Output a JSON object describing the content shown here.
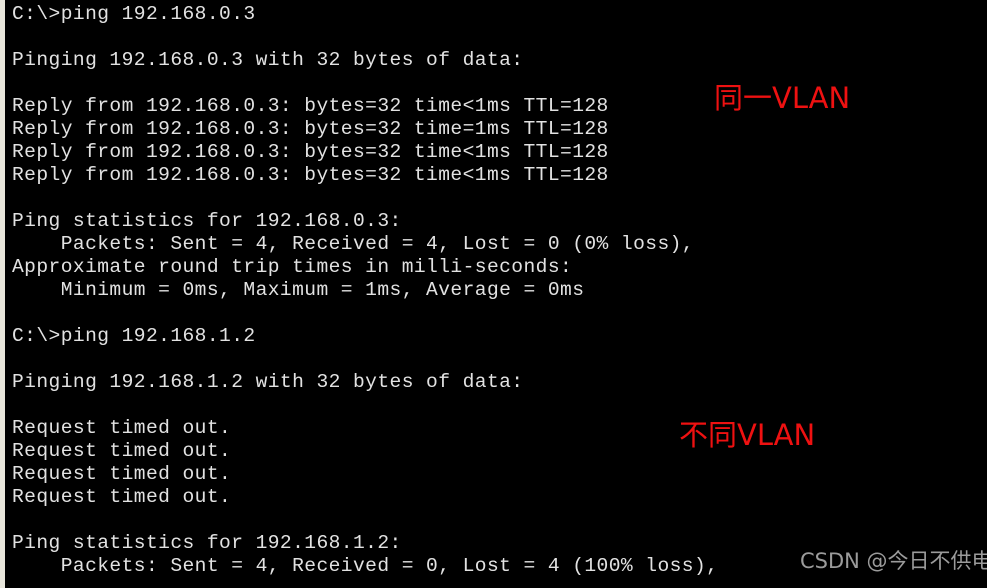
{
  "terminal": {
    "background_color": "#000000",
    "text_color": "#e2e2e2",
    "edge_strip_color": "#e8e6dc",
    "lines": [
      "C:\\>ping 192.168.0.3",
      "",
      "Pinging 192.168.0.3 with 32 bytes of data:",
      "",
      "Reply from 192.168.0.3: bytes=32 time<1ms TTL=128",
      "Reply from 192.168.0.3: bytes=32 time=1ms TTL=128",
      "Reply from 192.168.0.3: bytes=32 time<1ms TTL=128",
      "Reply from 192.168.0.3: bytes=32 time<1ms TTL=128",
      "",
      "Ping statistics for 192.168.0.3:",
      "    Packets: Sent = 4, Received = 4, Lost = 0 (0% loss),",
      "Approximate round trip times in milli-seconds:",
      "    Minimum = 0ms, Maximum = 1ms, Average = 0ms",
      "",
      "C:\\>ping 192.168.1.2",
      "",
      "Pinging 192.168.1.2 with 32 bytes of data:",
      "",
      "Request timed out.",
      "Request timed out.",
      "Request timed out.",
      "Request timed out.",
      "",
      "Ping statistics for 192.168.1.2:",
      "    Packets: Sent = 4, Received = 0, Lost = 4 (100% loss),"
    ]
  },
  "annotations": {
    "color": "#ee1111",
    "same_vlan": "同一VLAN",
    "different_vlan": "不同VLAN"
  },
  "watermark": {
    "text": "CSDN @今日不供电",
    "color": "#9b9b9b"
  }
}
